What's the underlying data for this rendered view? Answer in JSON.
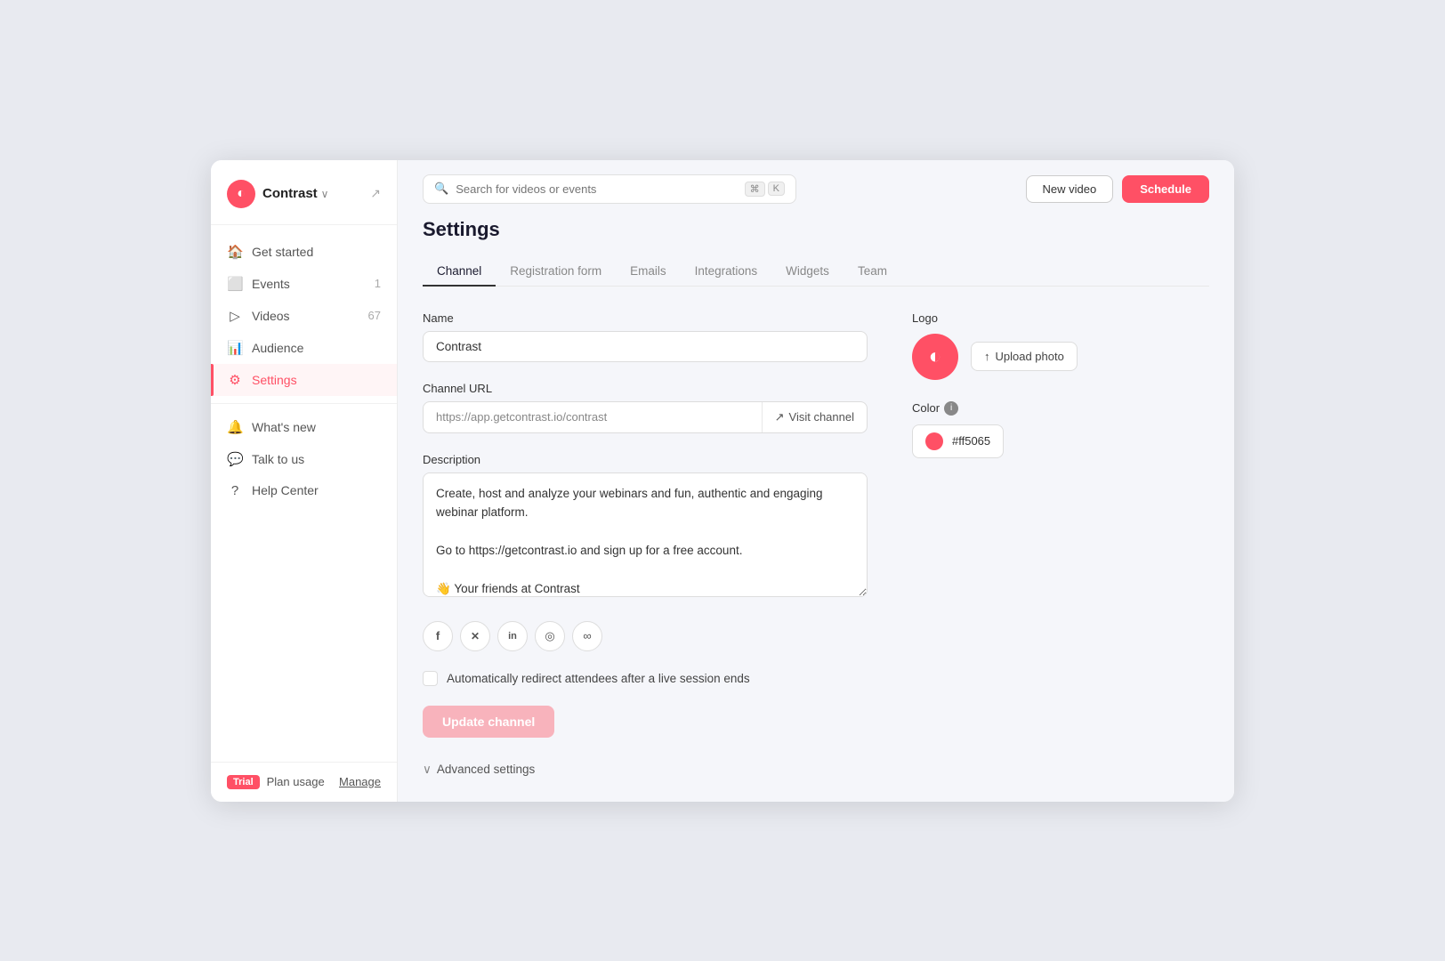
{
  "app": {
    "brand": "Contrast",
    "external_link_icon": "↗"
  },
  "topbar": {
    "search_placeholder": "Search for videos or events",
    "kbd1": "⌘",
    "kbd2": "K",
    "btn_new_video": "New video",
    "btn_schedule": "Schedule"
  },
  "sidebar": {
    "items": [
      {
        "id": "get-started",
        "label": "Get started",
        "icon": "🏠",
        "badge": null,
        "count": null
      },
      {
        "id": "events",
        "label": "Events",
        "icon": "📅",
        "badge": null,
        "count": "1"
      },
      {
        "id": "videos",
        "label": "Videos",
        "icon": "▶",
        "badge": null,
        "count": "67"
      },
      {
        "id": "audience",
        "label": "Audience",
        "icon": "📊",
        "badge": null,
        "count": null
      },
      {
        "id": "settings",
        "label": "Settings",
        "icon": "⚙",
        "badge": null,
        "count": null,
        "active": true
      }
    ],
    "bottom_items": [
      {
        "id": "whats-new",
        "label": "What's new",
        "icon": "🔔"
      },
      {
        "id": "talk-to-us",
        "label": "Talk to us",
        "icon": "💬"
      },
      {
        "id": "help-center",
        "label": "Help Center",
        "icon": "❓"
      }
    ],
    "trial_badge": "Trial",
    "plan_usage": "Plan usage",
    "manage": "Manage"
  },
  "settings": {
    "page_title": "Settings",
    "tabs": [
      {
        "id": "channel",
        "label": "Channel",
        "active": true
      },
      {
        "id": "registration-form",
        "label": "Registration form",
        "active": false
      },
      {
        "id": "emails",
        "label": "Emails",
        "active": false
      },
      {
        "id": "integrations",
        "label": "Integrations",
        "active": false
      },
      {
        "id": "widgets",
        "label": "Widgets",
        "active": false
      },
      {
        "id": "team",
        "label": "Team",
        "active": false
      }
    ],
    "name_label": "Name",
    "name_value": "Contrast",
    "channel_url_label": "Channel URL",
    "channel_url_value": "https://app.getcontrast.io/contrast",
    "visit_channel": "Visit channel",
    "description_label": "Description",
    "description_value": "Create, host and analyze your webinars and fun, authentic and engaging webinar platform.\n\nGo to https://getcontrast.io and sign up for a free account.\n\n👋 Your friends at Contrast",
    "social_icons": [
      {
        "id": "facebook",
        "icon": "f",
        "label": "Facebook"
      },
      {
        "id": "twitter",
        "icon": "𝕏",
        "label": "Twitter/X"
      },
      {
        "id": "linkedin",
        "icon": "in",
        "label": "LinkedIn"
      },
      {
        "id": "instagram",
        "icon": "◎",
        "label": "Instagram"
      },
      {
        "id": "link",
        "icon": "∞",
        "label": "Link"
      }
    ],
    "redirect_label": "Automatically redirect attendees after a live session ends",
    "update_btn": "Update channel",
    "advanced_settings": "Advanced settings",
    "logo_label": "Logo",
    "upload_photo_btn": "Upload photo",
    "color_label": "Color",
    "color_value": "#ff5065",
    "color_hex_display": "#ff5065"
  }
}
